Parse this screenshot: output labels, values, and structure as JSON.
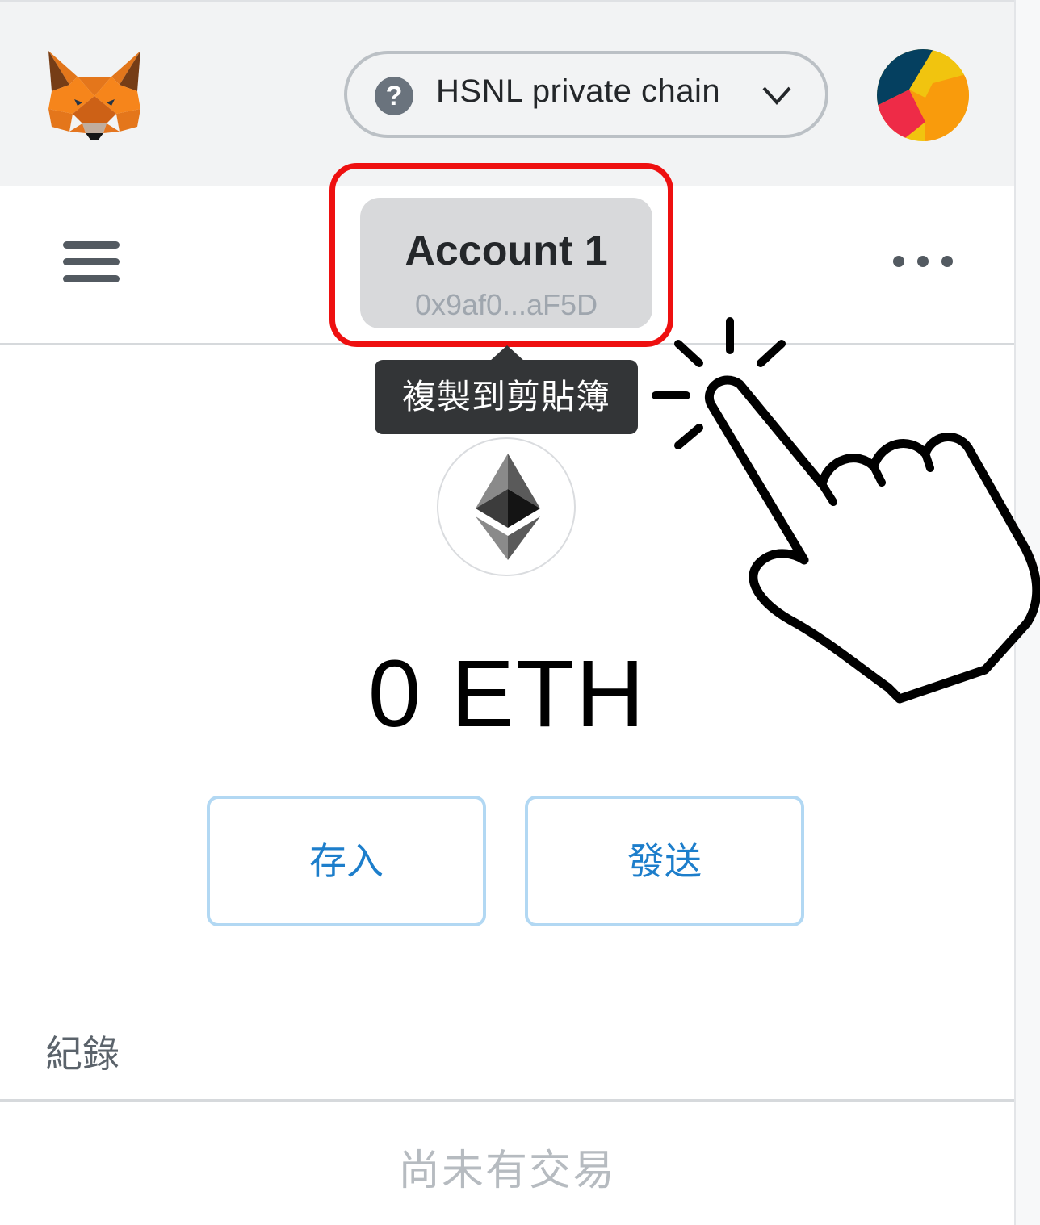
{
  "header": {
    "network_name": "HSNL private chain",
    "network_icon": "question-icon",
    "network_icon_glyph": "?",
    "logo": "metamask-fox-logo",
    "avatar": "identicon-avatar"
  },
  "account": {
    "name": "Account 1",
    "address": "0x9af0...aF5D",
    "tooltip": "複製到剪貼簿",
    "menu_icon": "hamburger-icon",
    "options_icon": "more-options-icon"
  },
  "wallet": {
    "token_icon": "ethereum-icon",
    "balance": "0 ETH",
    "deposit_label": "存入",
    "send_label": "發送"
  },
  "history": {
    "title": "紀錄",
    "empty_text": "尚未有交易"
  },
  "colors": {
    "highlight_box": "#ee1010",
    "button_border": "#b2d8f3",
    "button_text": "#1d7ecb",
    "tooltip_bg": "#333537"
  }
}
